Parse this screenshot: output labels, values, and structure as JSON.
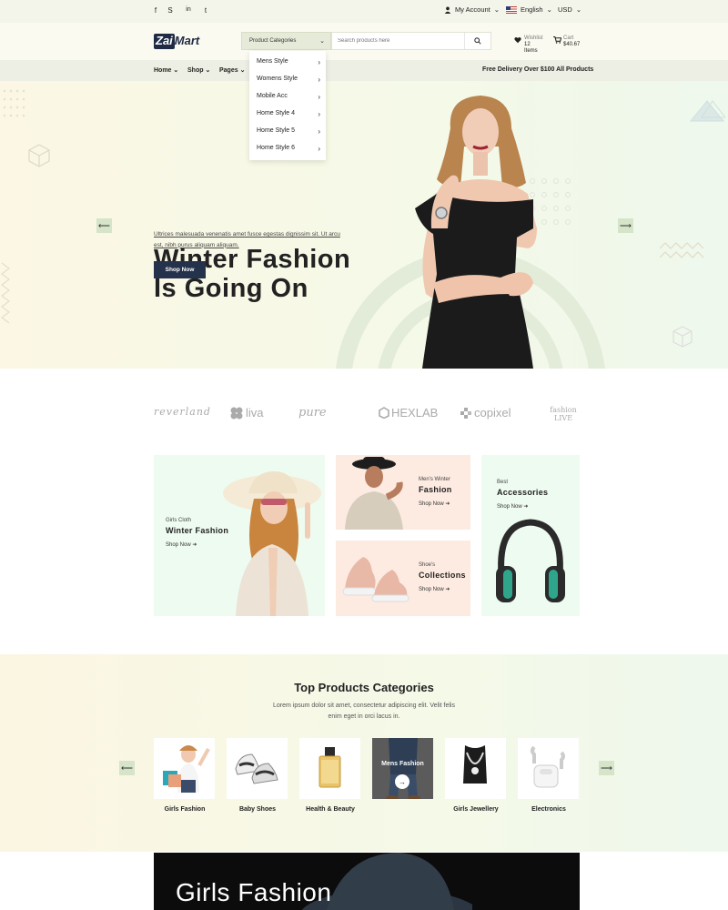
{
  "topbar": {
    "social": [
      {
        "name": "facebook-icon",
        "glyph": "f"
      },
      {
        "name": "skype-icon",
        "glyph": "S"
      },
      {
        "name": "linkedin-icon",
        "glyph": "in"
      },
      {
        "name": "twitter-icon",
        "glyph": "t"
      }
    ],
    "account_label": "My Account",
    "language_label": "English",
    "currency_label": "USD"
  },
  "header": {
    "logo_part1": "Zai",
    "logo_part2": "Mart",
    "category_select": "Product Categories",
    "search_placeholder": "Search products here",
    "wishlist_label": "Wishlist",
    "wishlist_count": "12 Items",
    "cart_label": "Cart",
    "cart_total": "$40.67"
  },
  "nav": {
    "items": [
      "Home",
      "Shop",
      "Pages"
    ],
    "free_delivery": "Free Delivery Over $100 All Products"
  },
  "dropdown": {
    "items": [
      "Mens Style",
      "Womens Style",
      "Mobile Acc",
      "Home Style 4",
      "Home Style 5",
      "Home Style 6"
    ]
  },
  "hero": {
    "title_line1": "Winter Fashion",
    "title_line2": "Is Going On",
    "subtitle_line1": "Ultrices malesuada venenatis amet fusce egestas dignissim sit. Ut arcu",
    "subtitle_line2": "est, nibh purus aliquam aliquam.",
    "button": "Shop Now"
  },
  "brands": [
    "reverland",
    "liva",
    "pure",
    "HEXLAB",
    "copixel",
    "fashion LIVE"
  ],
  "banners": {
    "winter": {
      "small": "Girls Cloth",
      "title": "Winter Fashion",
      "shop": "Shop Now"
    },
    "mens": {
      "small": "Men's Winter",
      "title": "Fashion",
      "shop": "Shop Now"
    },
    "shoes": {
      "small": "Shoe's",
      "title": "Collections",
      "shop": "Shop Now"
    },
    "accessories": {
      "small": "Best",
      "title": "Accessories",
      "shop": "Shop Now"
    }
  },
  "categories": {
    "title": "Top Products Categories",
    "desc_line1": "Lorem ipsum dolor sit amet, consectetur adipiscing elit. Velit felis",
    "desc_line2": "enim eget in orci lacus in.",
    "items": [
      "Girls Fashion",
      "Baby Shoes",
      "Health & Beauty",
      "Mens Fashion",
      "Girls Jewellery",
      "Electronics"
    ],
    "hover_label": "Mens Fashion"
  },
  "bottom_banner": {
    "title": "Girls Fashion"
  },
  "colors": {
    "dark_navy": "#25324b",
    "accent_green": "#d6e4c9",
    "cream": "#fbf7e4"
  }
}
